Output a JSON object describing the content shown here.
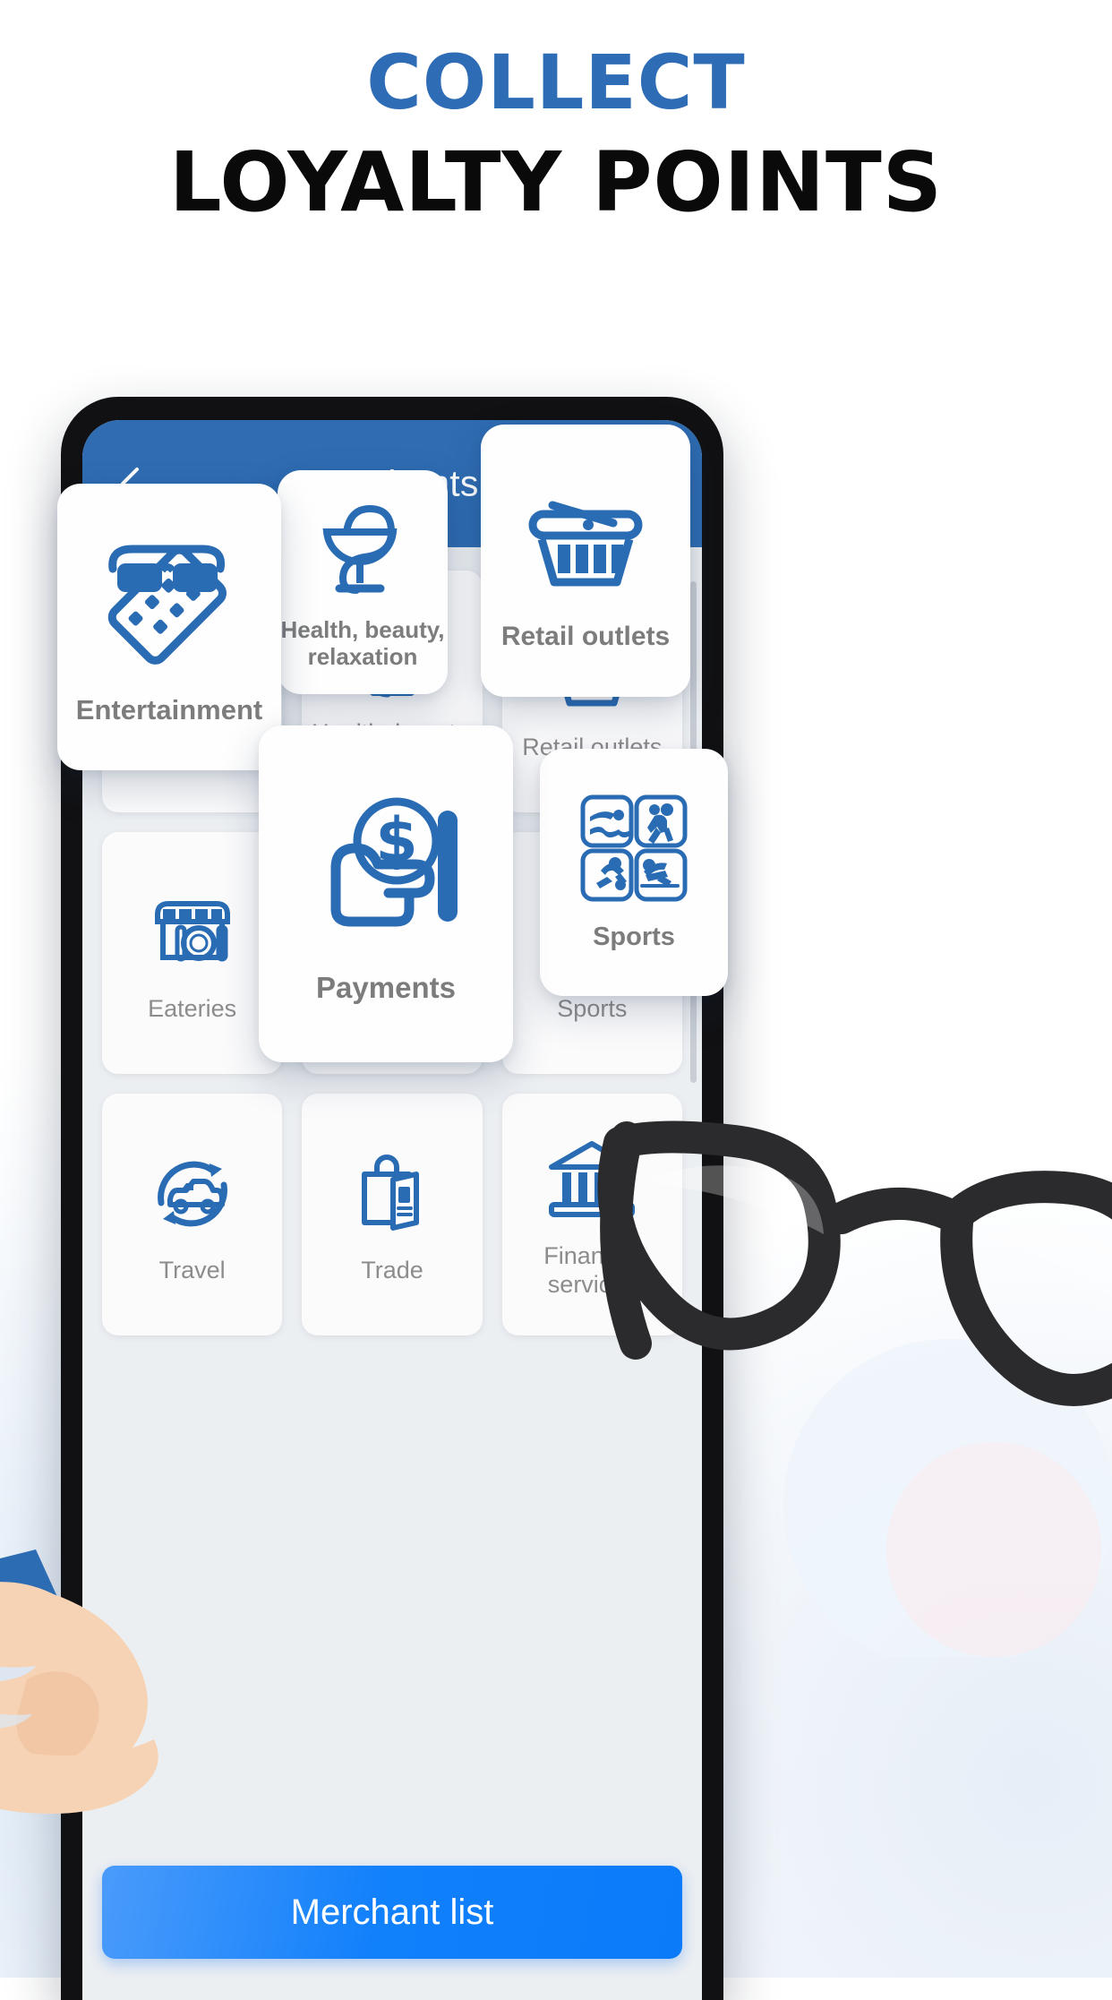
{
  "headline": {
    "line1": "COLLECT",
    "line2": "LOYALTY POINTS",
    "line1_color": "#2e6cb5",
    "line2_color": "#0a0a0a"
  },
  "app": {
    "accent_color": "#2f6cb2",
    "cta_color": "#0b7bfa",
    "appbar": {
      "title": "Merchants",
      "back_icon": "chevron-left-icon",
      "action_icon": "shield-lock-icon"
    },
    "grid_tiles": [
      {
        "label": "Entertainment",
        "icon": "movie-ticket-glasses-icon"
      },
      {
        "label": "Health, beauty, relaxation",
        "icon": "pharmacy-bowl-icon"
      },
      {
        "label": "Retail outlets",
        "icon": "shopping-basket-icon"
      },
      {
        "label": "Eateries",
        "icon": "restaurant-storefront-icon"
      },
      {
        "label": "Payments",
        "icon": "hand-coin-dollar-icon"
      },
      {
        "label": "Sports",
        "icon": "sports-pictograms-icon"
      },
      {
        "label": "Travel",
        "icon": "car-rental-icon"
      },
      {
        "label": "Trade",
        "icon": "shopping-bag-catalog-icon"
      },
      {
        "label": "Financial services",
        "icon": "bank-building-icon"
      }
    ],
    "cta": {
      "label": "Merchant list"
    }
  },
  "floating_cards": [
    {
      "id": "entertainment",
      "label": "Entertainment",
      "icon": "movie-ticket-glasses-icon"
    },
    {
      "id": "health",
      "label": "Health, beauty, relaxation",
      "icon": "pharmacy-bowl-icon"
    },
    {
      "id": "retail",
      "label": "Retail outlets",
      "icon": "shopping-basket-icon"
    },
    {
      "id": "payments",
      "label": "Payments",
      "icon": "hand-coin-dollar-icon"
    },
    {
      "id": "sports",
      "label": "Sports",
      "icon": "sports-pictograms-icon"
    }
  ],
  "decorations": [
    {
      "name": "hand-illustration"
    },
    {
      "name": "eyeglasses-illustration"
    }
  ]
}
